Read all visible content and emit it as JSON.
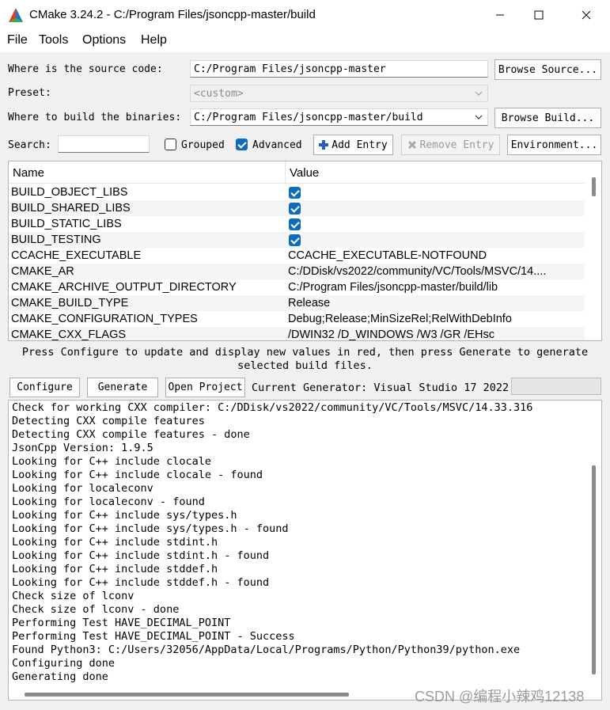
{
  "window": {
    "title": "CMake 3.24.2 - C:/Program Files/jsoncpp-master/build",
    "icon": "cmake-triangle-icon"
  },
  "menu": [
    {
      "label": "File"
    },
    {
      "label": "Tools"
    },
    {
      "label": "Options"
    },
    {
      "label": "Help"
    }
  ],
  "form": {
    "source_label": "Where is the source code:",
    "source_value": "C:/Program Files/jsoncpp-master",
    "browse_source": "Browse Source...",
    "preset_label": "Preset:",
    "preset_value": "<custom>",
    "binaries_label": "Where to build the binaries:",
    "binaries_value": "C:/Program Files/jsoncpp-master/build",
    "browse_build": "Browse Build...",
    "search_label": "Search:",
    "search_value": "",
    "grouped_label": "Grouped",
    "grouped_checked": false,
    "advanced_label": "Advanced",
    "advanced_checked": true,
    "add_entry": "Add Entry",
    "remove_entry": "Remove Entry",
    "environment": "Environment..."
  },
  "table": {
    "headers": [
      "Name",
      "Value"
    ],
    "rows": [
      {
        "name": "BUILD_OBJECT_LIBS",
        "value": "",
        "checkbox": true
      },
      {
        "name": "BUILD_SHARED_LIBS",
        "value": "",
        "checkbox": true
      },
      {
        "name": "BUILD_STATIC_LIBS",
        "value": "",
        "checkbox": true
      },
      {
        "name": "BUILD_TESTING",
        "value": "",
        "checkbox": true
      },
      {
        "name": "CCACHE_EXECUTABLE",
        "value": "CCACHE_EXECUTABLE-NOTFOUND",
        "checkbox": false
      },
      {
        "name": "CMAKE_AR",
        "value": "C:/DDisk/vs2022/community/VC/Tools/MSVC/14....",
        "checkbox": false
      },
      {
        "name": "CMAKE_ARCHIVE_OUTPUT_DIRECTORY",
        "value": "C:/Program Files/jsoncpp-master/build/lib",
        "checkbox": false
      },
      {
        "name": "CMAKE_BUILD_TYPE",
        "value": "Release",
        "checkbox": false
      },
      {
        "name": "CMAKE_CONFIGURATION_TYPES",
        "value": "Debug;Release;MinSizeRel;RelWithDebInfo",
        "checkbox": false
      },
      {
        "name": "CMAKE_CXX_FLAGS",
        "value": "/DWIN32 /D_WINDOWS /W3 /GR /EHsc",
        "checkbox": false
      }
    ]
  },
  "hint": {
    "line1": "Press Configure to update and display new values in red, then press Generate to generate",
    "line2": "selected build files."
  },
  "actions": {
    "configure": "Configure",
    "generate": "Generate",
    "open_project": "Open Project",
    "generator_text": "Current Generator: Visual Studio 17 2022"
  },
  "log": [
    "Check for working CXX compiler: C:/DDisk/vs2022/community/VC/Tools/MSVC/14.33.316",
    "Detecting CXX compile features",
    "Detecting CXX compile features - done",
    "JsonCpp Version: 1.9.5",
    "Looking for C++ include clocale",
    "Looking for C++ include clocale - found",
    "Looking for localeconv",
    "Looking for localeconv - found",
    "Looking for C++ include sys/types.h",
    "Looking for C++ include sys/types.h - found",
    "Looking for C++ include stdint.h",
    "Looking for C++ include stdint.h - found",
    "Looking for C++ include stddef.h",
    "Looking for C++ include stddef.h - found",
    "Check size of lconv",
    "Check size of lconv - done",
    "Performing Test HAVE_DECIMAL_POINT",
    "Performing Test HAVE_DECIMAL_POINT - Success",
    "Found Python3: C:/Users/32056/AppData/Local/Programs/Python/Python39/python.exe",
    "Configuring done",
    "Generating done"
  ],
  "watermark": "CSDN @编程小辣鸡12138",
  "colors": {
    "accent": "#0f6cbd"
  }
}
